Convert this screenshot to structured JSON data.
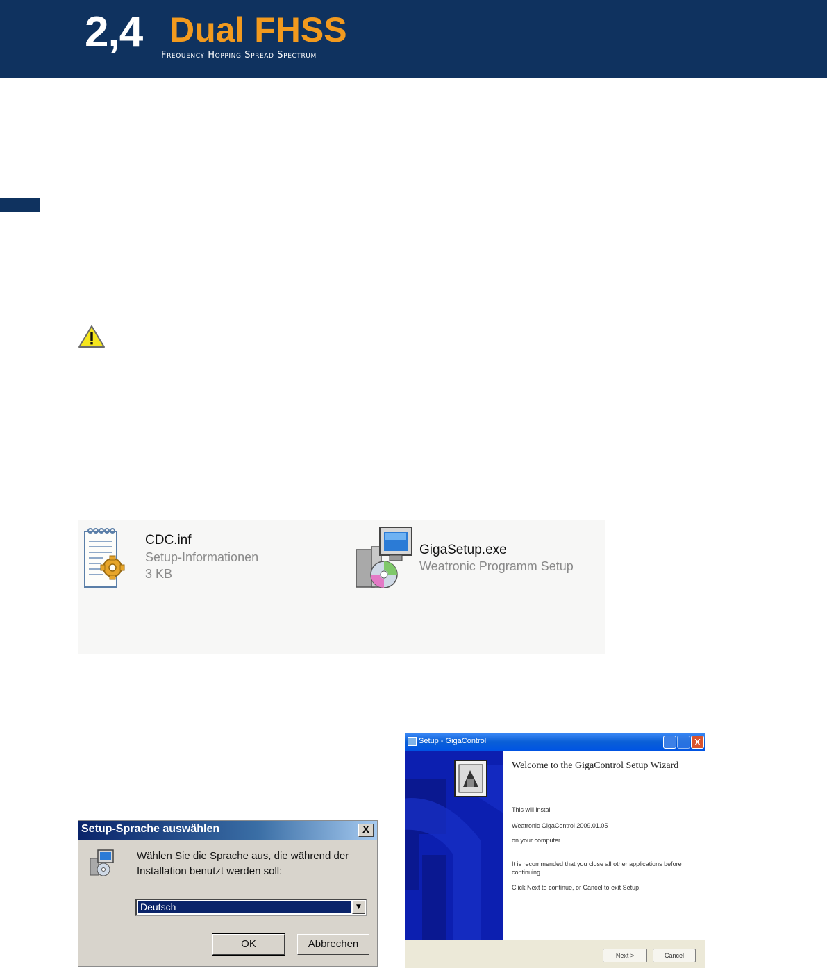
{
  "banner": {
    "logo_number": "2,4",
    "logo_word": "Dual FHSS",
    "logo_subtitle": "Frequency Hopping Spread Spectrum",
    "colors": {
      "background": "#0f325f",
      "accent": "#f29a1e"
    }
  },
  "warning": {
    "icon": "warning-triangle-icon",
    "color": "#f5e61e"
  },
  "files": [
    {
      "name": "CDC.inf",
      "type": "Setup-Informationen",
      "size": "3 KB",
      "icon": "inf-document-gear-icon"
    },
    {
      "name": "GigaSetup.exe",
      "type": "Weatronic Programm Setup",
      "icon": "installer-computer-cd-icon"
    }
  ],
  "language_dialog": {
    "title": "Setup-Sprache auswählen",
    "close_glyph": "X",
    "message": "Wählen Sie die Sprache aus, die während der Installation benutzt werden soll:",
    "selected_language": "Deutsch",
    "ok_label": "OK",
    "cancel_label": "Abbrechen"
  },
  "wizard": {
    "title": "Setup - GigaControl",
    "heading": "Welcome to the GigaControl Setup Wizard",
    "lines": [
      "This will install",
      "Weatronic GigaControl  2009.01.05",
      "on your computer.",
      "It is recommended that you close all other applications before continuing.",
      "Click Next to continue, or Cancel to exit Setup."
    ],
    "next_label": "Next >",
    "cancel_label": "Cancel",
    "close_glyph": "X"
  }
}
